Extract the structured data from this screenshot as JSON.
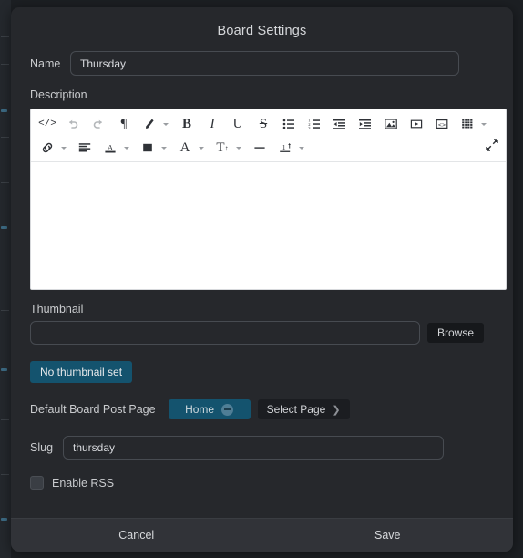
{
  "modal": {
    "title": "Board Settings",
    "name": {
      "label": "Name",
      "value": "Thursday",
      "placeholder": ""
    },
    "description": {
      "label": "Description",
      "value": ""
    },
    "thumbnail": {
      "label": "Thumbnail",
      "value": "",
      "placeholder": "",
      "browse_label": "Browse",
      "status_label": "No thumbnail set"
    },
    "default_board_post_page": {
      "label": "Default Board Post Page",
      "selected": "Home",
      "remove_icon": "minus-circle-icon",
      "select_label": "Select Page",
      "select_icon": "chevron-right-icon"
    },
    "slug": {
      "label": "Slug",
      "value": "thursday",
      "placeholder": ""
    },
    "rss": {
      "label": "Enable RSS",
      "checked": false
    },
    "footer": {
      "cancel_label": "Cancel",
      "save_label": "Save"
    }
  },
  "editor": {
    "toolbar_row1": [
      {
        "name": "code-view-icon",
        "glyph": "</>",
        "dim": false,
        "caret": false
      },
      {
        "name": "undo-icon",
        "glyph": "",
        "dim": true,
        "caret": false
      },
      {
        "name": "redo-icon",
        "glyph": "",
        "dim": true,
        "caret": false
      },
      {
        "name": "paragraph-format-icon",
        "glyph": "¶",
        "dim": false,
        "caret": false
      },
      {
        "name": "highlighter-icon",
        "glyph": "",
        "dim": false,
        "caret": true
      },
      {
        "name": "bold-icon",
        "glyph": "B",
        "dim": false,
        "caret": false
      },
      {
        "name": "italic-icon",
        "glyph": "I",
        "dim": false,
        "caret": false
      },
      {
        "name": "underline-icon",
        "glyph": "U",
        "dim": false,
        "caret": false
      },
      {
        "name": "strikethrough-icon",
        "glyph": "S",
        "dim": false,
        "caret": false
      },
      {
        "name": "unordered-list-icon",
        "glyph": "",
        "dim": false,
        "caret": false
      },
      {
        "name": "ordered-list-icon",
        "glyph": "",
        "dim": false,
        "caret": false
      },
      {
        "name": "outdent-icon",
        "glyph": "",
        "dim": false,
        "caret": false
      },
      {
        "name": "indent-icon",
        "glyph": "",
        "dim": false,
        "caret": false
      },
      {
        "name": "insert-image-icon",
        "glyph": "",
        "dim": false,
        "caret": false
      },
      {
        "name": "insert-video-icon",
        "glyph": "",
        "dim": false,
        "caret": false
      },
      {
        "name": "insert-embed-icon",
        "glyph": "",
        "dim": false,
        "caret": false
      },
      {
        "name": "insert-table-icon",
        "glyph": "",
        "dim": false,
        "caret": true
      }
    ],
    "toolbar_row2": [
      {
        "name": "insert-link-icon",
        "glyph": "",
        "dim": false,
        "caret": true
      },
      {
        "name": "align-icon",
        "glyph": "",
        "dim": false,
        "caret": false
      },
      {
        "name": "text-color-icon",
        "glyph": "A",
        "dim": false,
        "caret": true
      },
      {
        "name": "background-color-icon",
        "glyph": "",
        "dim": false,
        "caret": true
      },
      {
        "name": "font-family-icon",
        "glyph": "A",
        "dim": false,
        "caret": true
      },
      {
        "name": "font-size-icon",
        "glyph": "T",
        "dim": false,
        "caret": true
      },
      {
        "name": "horizontal-rule-icon",
        "glyph": "",
        "dim": false,
        "caret": false
      },
      {
        "name": "line-height-icon",
        "glyph": "",
        "dim": false,
        "caret": true
      }
    ],
    "expand_icon": "expand-fullscreen-icon",
    "content": ""
  },
  "colors": {
    "page_background": "#1c1f23",
    "modal_background": "#26282c",
    "accent_blue": "#14536e",
    "footer_background": "#313338",
    "editor_background": "#ffffff"
  }
}
